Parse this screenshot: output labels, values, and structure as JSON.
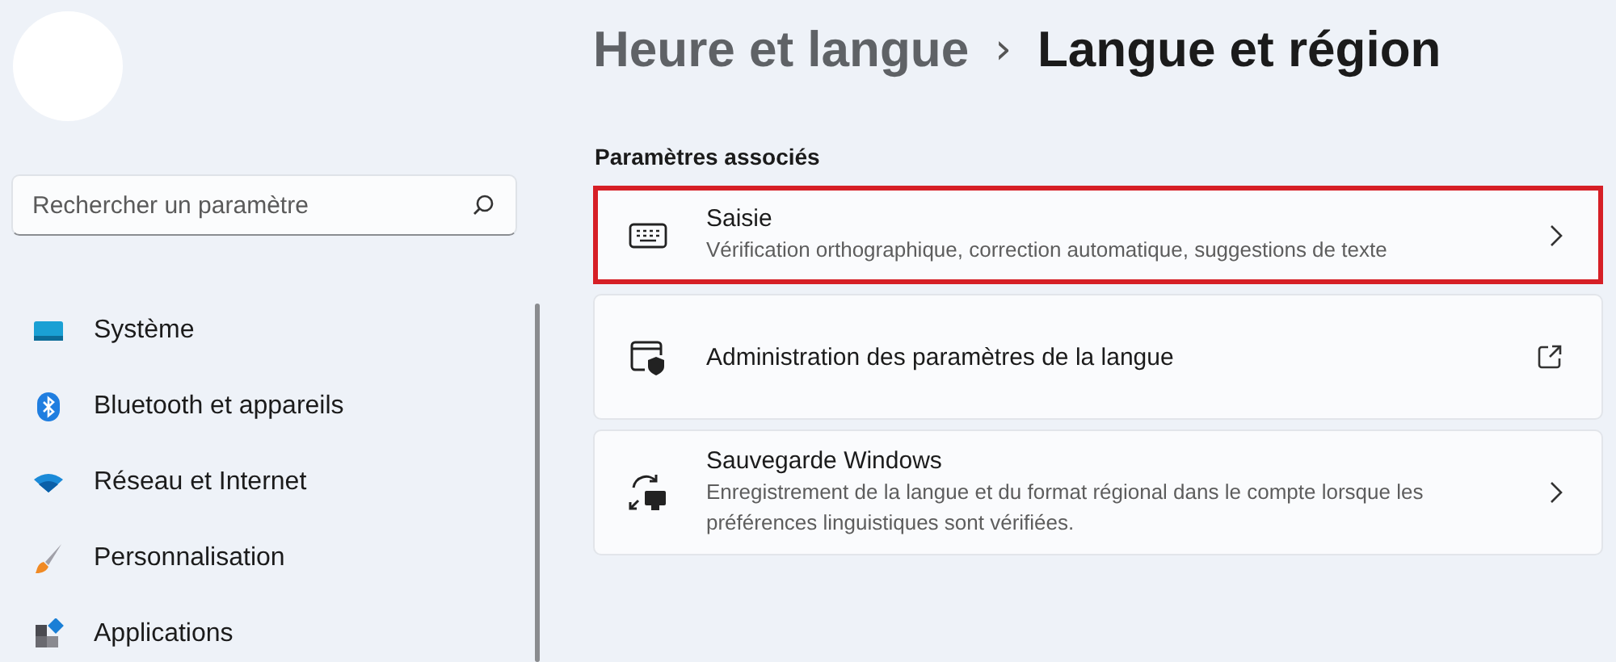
{
  "sidebar": {
    "search": {
      "placeholder": "Rechercher un paramètre"
    },
    "items": [
      {
        "label": "Système",
        "selected": false
      },
      {
        "label": "Bluetooth et appareils",
        "selected": false
      },
      {
        "label": "Réseau et Internet",
        "selected": false
      },
      {
        "label": "Personnalisation",
        "selected": false
      },
      {
        "label": "Applications",
        "selected": false
      }
    ]
  },
  "breadcrumb": [
    {
      "label": "Heure et langue",
      "current": false
    },
    {
      "label": "Langue et région",
      "current": true
    }
  ],
  "breadcrumb_separator": "›",
  "section_title": "Paramètres associés",
  "cards": [
    {
      "title": "Saisie",
      "description": "Vérification orthographique, correction automatique, suggestions de texte",
      "kind": "chevron",
      "highlighted": true
    },
    {
      "title": "Administration des paramètres de la langue",
      "kind": "external",
      "highlighted": false
    },
    {
      "title": "Sauvegarde Windows",
      "description": "Enregistrement de la langue et du format régional dans le compte lorsque les préférences linguistiques sont vérifiées.",
      "kind": "chevron",
      "highlighted": false
    }
  ]
}
